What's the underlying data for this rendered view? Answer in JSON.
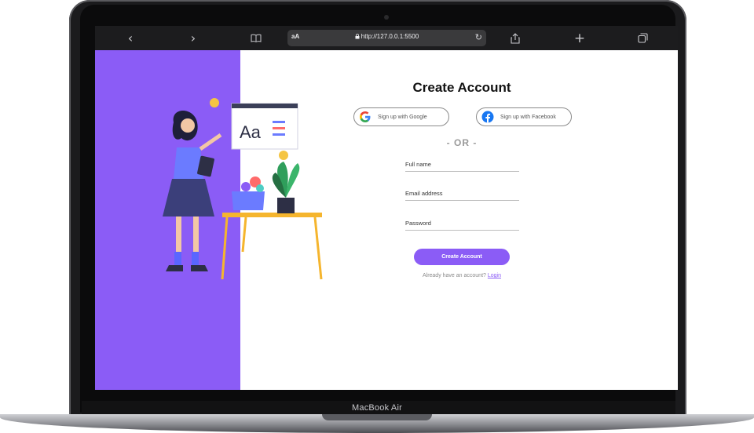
{
  "device": {
    "brand": "MacBook Air"
  },
  "browser": {
    "reader_icon": "book-icon",
    "text_size_label": "aA",
    "lock_icon": "lock-icon",
    "url": "http://127.0.0.1:5500",
    "reload_icon": "reload-icon",
    "share_icon": "share-icon",
    "new_tab_label": "+",
    "tabs_icon": "tabs-icon",
    "back_label": "‹",
    "forward_label": "›"
  },
  "page": {
    "accent_color": "#8b5cf6",
    "title": "Create Account",
    "google_label": "Sign up with Google",
    "facebook_label": "Sign up with Facebook",
    "divider": "- OR -",
    "fields": {
      "full_name": "Full name",
      "email": "Email address",
      "password": "Password"
    },
    "submit_label": "Create Account",
    "login_prompt": "Already have an account?",
    "login_link": "Login",
    "illustration_label": "Aa"
  }
}
